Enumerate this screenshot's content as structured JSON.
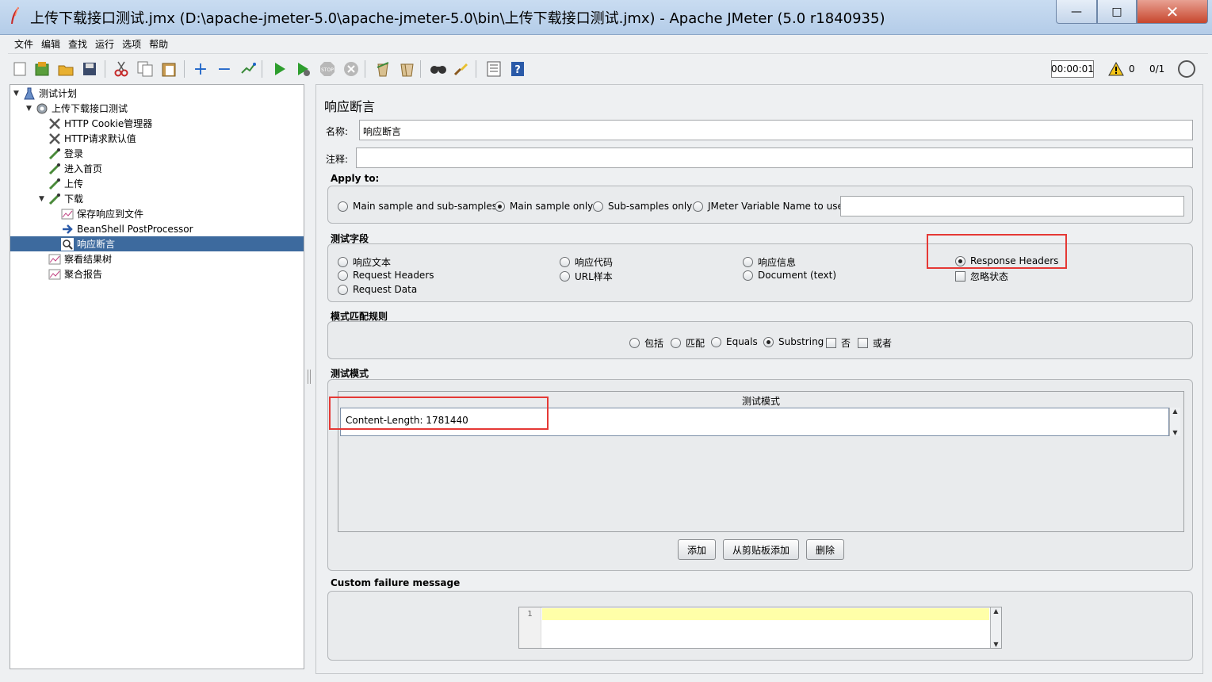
{
  "window": {
    "title": "上传下载接口测试.jmx (D:\\apache-jmeter-5.0\\apache-jmeter-5.0\\bin\\上传下载接口测试.jmx) - Apache JMeter (5.0 r1840935)",
    "minimize": "—",
    "maximize": "□",
    "close": "✕"
  },
  "menu": [
    "文件",
    "编辑",
    "查找",
    "运行",
    "选项",
    "帮助"
  ],
  "status": {
    "timer": "00:00:01",
    "warnings": "0",
    "threads": "0/1"
  },
  "tree": [
    {
      "label": "测试计划",
      "icon": "flask-icon",
      "expanded": true
    },
    {
      "label": "上传下载接口测试",
      "icon": "gear-icon",
      "expanded": true
    },
    {
      "label": "HTTP Cookie管理器",
      "icon": "wrench-icon"
    },
    {
      "label": "HTTP请求默认值",
      "icon": "wrench-icon"
    },
    {
      "label": "登录",
      "icon": "pipette-icon"
    },
    {
      "label": "进入首页",
      "icon": "pipette-icon"
    },
    {
      "label": "上传",
      "icon": "pipette-icon"
    },
    {
      "label": "下载",
      "icon": "pipette-icon",
      "expanded": true
    },
    {
      "label": "保存响应到文件",
      "icon": "chart-icon"
    },
    {
      "label": "BeanShell PostProcessor",
      "icon": "arrow-icon"
    },
    {
      "label": "响应断言",
      "icon": "magnifier-icon",
      "selected": true
    },
    {
      "label": "察看结果树",
      "icon": "chart-icon"
    },
    {
      "label": "聚合报告",
      "icon": "chart-icon"
    }
  ],
  "assertion": {
    "panel_title": "响应断言",
    "name_label": "名称:",
    "name_value": "响应断言",
    "comment_label": "注释:",
    "comment_value": "",
    "apply_to": {
      "label": "Apply to:",
      "options": [
        "Main sample and sub-samples",
        "Main sample only",
        "Sub-samples only",
        "JMeter Variable Name to use"
      ],
      "selected": "Main sample only",
      "variable_value": ""
    },
    "field_to_test": {
      "label": "测试字段",
      "options": [
        "响应文本",
        "Request Headers",
        "Request Data",
        "响应代码",
        "URL样本",
        "响应信息",
        "Document (text)",
        "Response Headers"
      ],
      "selected": "Response Headers",
      "ignore_status_label": "忽略状态"
    },
    "matching_rules": {
      "label": "模式匹配规则",
      "options": [
        "包括",
        "匹配",
        "Equals",
        "Substring"
      ],
      "selected": "Substring",
      "not_label": "否",
      "or_label": "或者"
    },
    "patterns": {
      "label": "测试模式",
      "column_header": "测试模式",
      "rows": [
        "Content-Length: 1781440"
      ],
      "add_button": "添加",
      "add_from_clipboard_button": "从剪贴板添加",
      "delete_button": "删除"
    },
    "custom_failure": {
      "label": "Custom failure message",
      "line_number": "1",
      "value": ""
    }
  },
  "colors": {
    "selection": "#3d6a9e",
    "highlight_box": "#e53935",
    "editor_line": "#ffffa8"
  }
}
